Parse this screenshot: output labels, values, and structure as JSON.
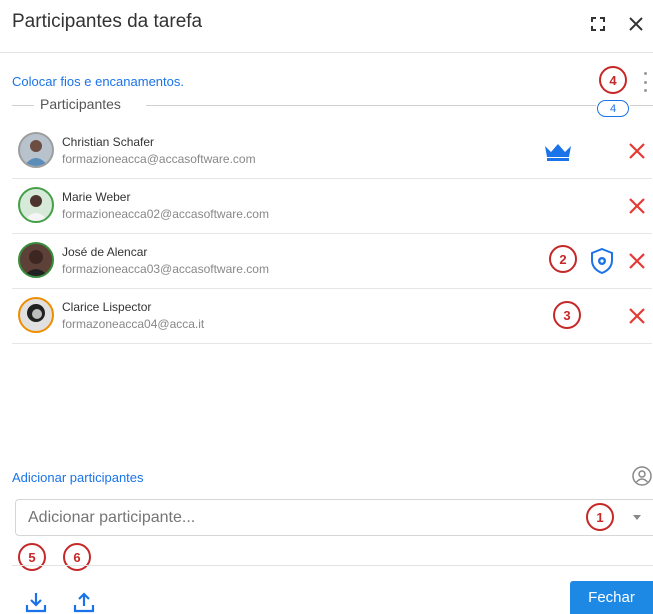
{
  "dialog": {
    "title": "Participantes da tarefa",
    "task_name": "Colocar fios e encanamentos.",
    "close_label": "Fechar"
  },
  "participants_section": {
    "label": "Participantes",
    "count": "4",
    "items": [
      {
        "name": "Christian Schafer",
        "email": "formazioneacca@accasoftware.com",
        "role_icon": "crown-icon"
      },
      {
        "name": "Marie Weber",
        "email": "formazioneacca02@accasoftware.com",
        "role_icon": ""
      },
      {
        "name": "José de Alencar",
        "email": "formazioneacca03@accasoftware.com",
        "role_icon": "admin-shield-icon"
      },
      {
        "name": "Clarice Lispector",
        "email": "formazoneacca04@acca.it",
        "role_icon": ""
      }
    ]
  },
  "add_section": {
    "label": "Adicionar participantes",
    "placeholder": "Adicionar participante..."
  },
  "markers": [
    "1",
    "2",
    "3",
    "4",
    "5",
    "6"
  ],
  "colors": {
    "accent": "#1a73e8",
    "remove": "#e53935",
    "marker": "#c62828",
    "button": "#1e88e5"
  }
}
